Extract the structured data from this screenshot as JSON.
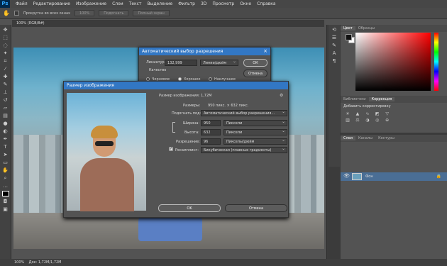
{
  "app": {
    "logo": "Ps",
    "menu": [
      "Файл",
      "Редактирование",
      "Изображение",
      "Слои",
      "Текст",
      "Выделение",
      "Фильтр",
      "3D",
      "Просмотр",
      "Окно",
      "Справка"
    ]
  },
  "options": {
    "scroll_all": "Прокрутка во всех окнах",
    "zoom": "100%",
    "fit": "Подогнать",
    "fill": "Полный экран"
  },
  "document": {
    "tab": "100% (RGB/8#)",
    "status_zoom": "100%",
    "status_doc": "Док: 1,72M/1,72M"
  },
  "color_panel": {
    "tabs": [
      "Цвет",
      "Образцы"
    ]
  },
  "adjust_panel": {
    "tabs": [
      "Библиотеки",
      "Коррекция"
    ],
    "hint": "Добавить корректировку"
  },
  "layers_panel": {
    "tabs": [
      "Слои",
      "Каналы",
      "Контуры"
    ],
    "layer_name": "Фон"
  },
  "res_dialog": {
    "title": "Автоматический выбор разрешения",
    "screen_label": "Линиатура:",
    "screen_value": "132,999",
    "unit": "Линии/дюйм",
    "quality": "Качество",
    "q_draft": "Черновое",
    "q_good": "Хорошее",
    "q_best": "Наилучшее",
    "ok": "ОК",
    "cancel": "Отмена"
  },
  "size_dialog": {
    "title": "Размер изображения",
    "image_size": "Размер изображения:  1,72M",
    "dimensions_label": "Размеры:",
    "dimensions_value": "950 пикс.  ×  632 пикс.",
    "fit_label": "Подогнать под:",
    "fit_value": "Автоматический выбор разрешения...",
    "width_label": "Ширина:",
    "width_value": "950",
    "width_unit": "Пиксели",
    "height_label": "Высота:",
    "height_value": "632",
    "height_unit": "Пиксели",
    "res_label": "Разрешение:",
    "res_value": "96",
    "res_unit": "Пикселы/дюйм",
    "resample_label": "Ресамплинг:",
    "resample_value": "Бикубическая (плавные градиенты)",
    "ok": "OK",
    "cancel": "Отмена"
  },
  "colors": {
    "accent": "#3277c4",
    "canvas_sky": "#6fb2cd"
  }
}
